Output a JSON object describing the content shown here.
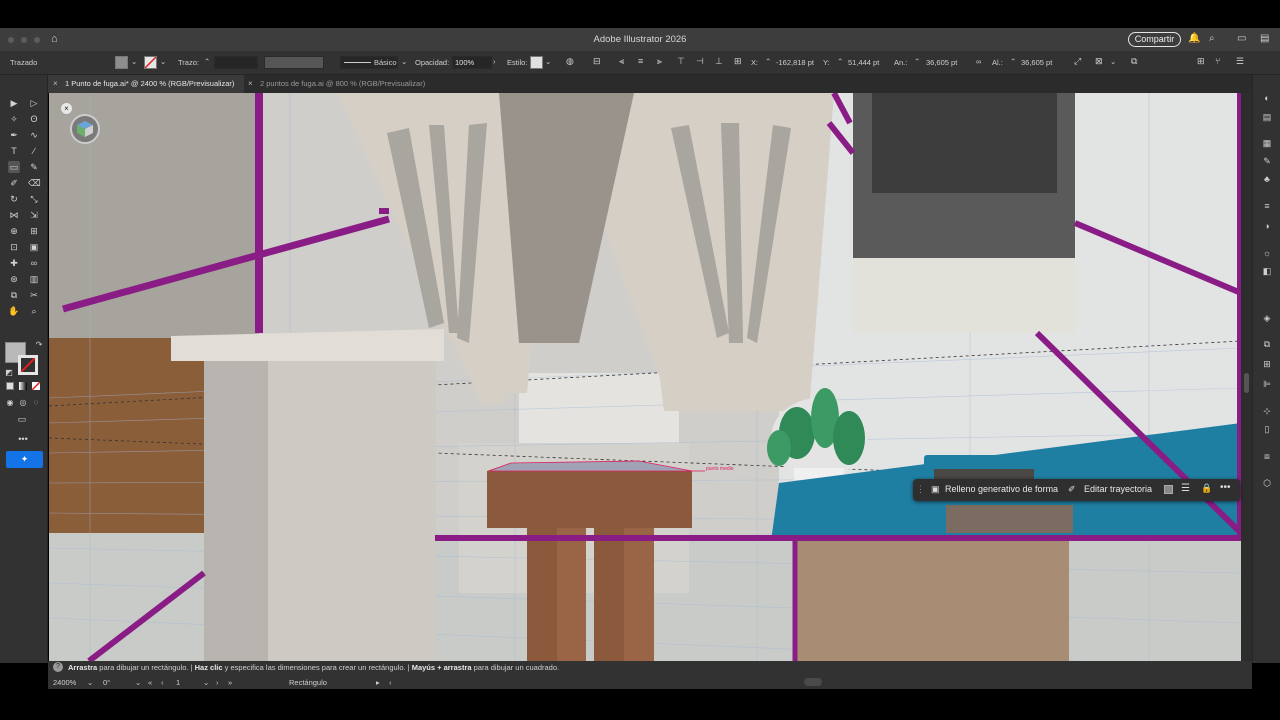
{
  "app": {
    "title": "Adobe Illustrator 2026",
    "share_label": "Compartir"
  },
  "controlbar": {
    "selection_label": "Trazado",
    "stroke_label": "Trazo:",
    "profile_label": "Básico",
    "opacity_label": "Opacidad:",
    "opacity_value": "100%",
    "style_label": "Estilo:",
    "x_label": "X:",
    "x_value": "-162,818 pt",
    "y_label": "Y:",
    "y_value": "51,444 pt",
    "w_label": "An.:",
    "w_value": "36,605 pt",
    "h_label": "Al.:",
    "h_value": "36,605 pt"
  },
  "tabs": [
    {
      "label": "1 Punto de fuga.ai* @ 2400 % (RGB/Previsualizar)",
      "active": true
    },
    {
      "label": "2 puntos de fuga.ai @ 800 % (RGB/Previsualizar)",
      "active": false
    }
  ],
  "toolbar": {
    "icons": [
      "selection-icon",
      "direct-selection-icon",
      "magic-wand-icon",
      "lasso-icon",
      "pen-icon",
      "curvature-icon",
      "type-icon",
      "line-icon",
      "rectangle-icon",
      "paintbrush-icon",
      "shaper-icon",
      "eraser-icon",
      "rotate-icon",
      "scale-icon",
      "width-icon",
      "free-transform-icon",
      "shape-builder-icon",
      "perspective-grid-icon",
      "mesh-icon",
      "gradient-icon",
      "eyedropper-icon",
      "blend-icon",
      "symbol-sprayer-icon",
      "column-graph-icon",
      "artboard-icon",
      "slice-icon",
      "hand-icon",
      "zoom-icon"
    ],
    "more_label": "•••"
  },
  "canvas": {
    "anchor_label": "punto medio"
  },
  "contextual_bar": {
    "generative_fill_label": "Relleno generativo de forma",
    "edit_path_label": "Editar trayectoria"
  },
  "status": {
    "hint_1_bold": "Arrastra",
    "hint_1": " para dibujar un rectángulo. | ",
    "hint_2_bold": "Haz clic",
    "hint_2": " y especifica las dimensiones para crear un rectángulo. | ",
    "hint_3_bold": "Mayús + arrastra",
    "hint_3": " para dibujar un cuadrado."
  },
  "bottombar": {
    "zoom": "2400%",
    "rotation": "0°",
    "artboard": "1",
    "tool": "Rectángulo"
  },
  "colors": {
    "guide_purple": "#8a1c86",
    "stool_brown": "#8b5a3c",
    "cardboard": "#a98c74",
    "blue": "#1f7fa3",
    "leaf_green": "#2f8a57"
  }
}
